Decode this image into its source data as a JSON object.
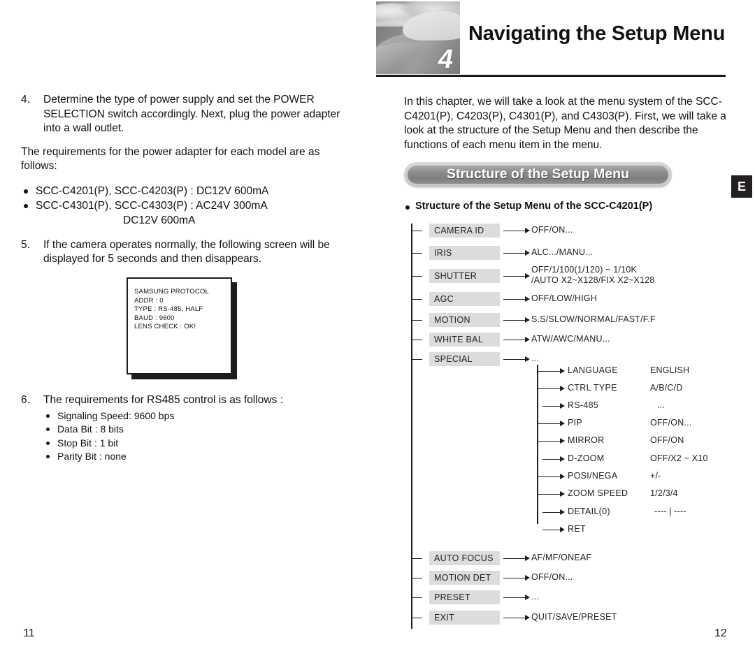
{
  "header": {
    "chapter_number": "4",
    "title": "Navigating the Setup Menu",
    "thumb_alt": "desert-dune-photo"
  },
  "left_column": {
    "step4": {
      "number": "4.",
      "text": "Determine the type of power supply and set the POWER SELECTION switch accordingly. Next, plug the power adapter into a wall outlet."
    },
    "adapter_intro": "The requirements for the power adapter for each model are as follows:",
    "adapter_bullets": [
      "SCC-C4201(P), SCC-C4203(P) : DC12V 600mA",
      "SCC-C4301(P), SCC-C4303(P) : AC24V 300mA"
    ],
    "adapter_bullets_cont": "DC12V 600mA",
    "step5": {
      "number": "5.",
      "text": "If the camera operates normally, the following screen will be displayed for 5 seconds and then disappears."
    },
    "osd_screen": {
      "lines": [
        "SAMSUNG PROTOCOL",
        "ADDR : 0",
        "TYPE : RS-485, HALF",
        "BAUD : 9600",
        "LENS CHECK : OK!"
      ]
    },
    "step6": {
      "number": "6.",
      "text": "The requirements for RS485 control is as follows :"
    },
    "rs485_bullets": [
      "Signaling Speed: 9600 bps",
      "Data Bit : 8 bits",
      "Stop Bit : 1 bit",
      "Parity Bit : none"
    ]
  },
  "right_column": {
    "intro": "In this chapter, we will take a look at the menu system of the SCC-C4201(P), C4203(P), C4301(P), and C4303(P). First, we will take a look at the structure of the Setup Menu and then describe the functions of each menu item in the menu.",
    "section_title": "Structure of the Setup Menu",
    "language_tab": "E",
    "subheading": "Structure of the Setup Menu of the SCC-C4201(P)"
  },
  "tree": {
    "main_nodes": [
      {
        "label": "CAMERA ID",
        "value": "OFF/ON..."
      },
      {
        "label": "IRIS",
        "value": "ALC.../MANU..."
      },
      {
        "label": "SHUTTER",
        "value": "OFF/1/100(1/120) ~ 1/10K\n/AUTO X2~X128/FIX X2~X128"
      },
      {
        "label": "AGC",
        "value": "OFF/LOW/HIGH"
      },
      {
        "label": "MOTION",
        "value": "S.S/SLOW/NORMAL/FAST/F.F"
      },
      {
        "label": "WHITE BAL",
        "value": "ATW/AWC/MANU..."
      },
      {
        "label": "SPECIAL",
        "value": "..."
      },
      {
        "label": "AUTO FOCUS",
        "value": "AF/MF/ONEAF"
      },
      {
        "label": "MOTION DET",
        "value": "OFF/ON..."
      },
      {
        "label": "PRESET",
        "value": "..."
      },
      {
        "label": "EXIT",
        "value": "QUIT/SAVE/PRESET"
      }
    ],
    "special_submenu": [
      {
        "label": "LANGUAGE",
        "value": "ENGLISH"
      },
      {
        "label": "CTRL TYPE",
        "value": "A/B/C/D"
      },
      {
        "label": "RS-485",
        "value": "..."
      },
      {
        "label": "PIP",
        "value": "OFF/ON..."
      },
      {
        "label": "MIRROR",
        "value": "OFF/ON"
      },
      {
        "label": "D-ZOOM",
        "value": "OFF/X2 ~ X10"
      },
      {
        "label": "POSI/NEGA",
        "value": "+/-"
      },
      {
        "label": "ZOOM SPEED",
        "value": "1/2/3/4"
      },
      {
        "label": "DETAIL(0)",
        "value": "---- | ----"
      },
      {
        "label": "RET",
        "value": ""
      }
    ]
  },
  "footer": {
    "page_left": "11",
    "page_right": "12"
  },
  "colors": {
    "chip_gray": "#dcdcdc",
    "line_black": "#1e1e1e",
    "pill_dark": "#8c8c8c",
    "tab_black": "#231f20"
  }
}
